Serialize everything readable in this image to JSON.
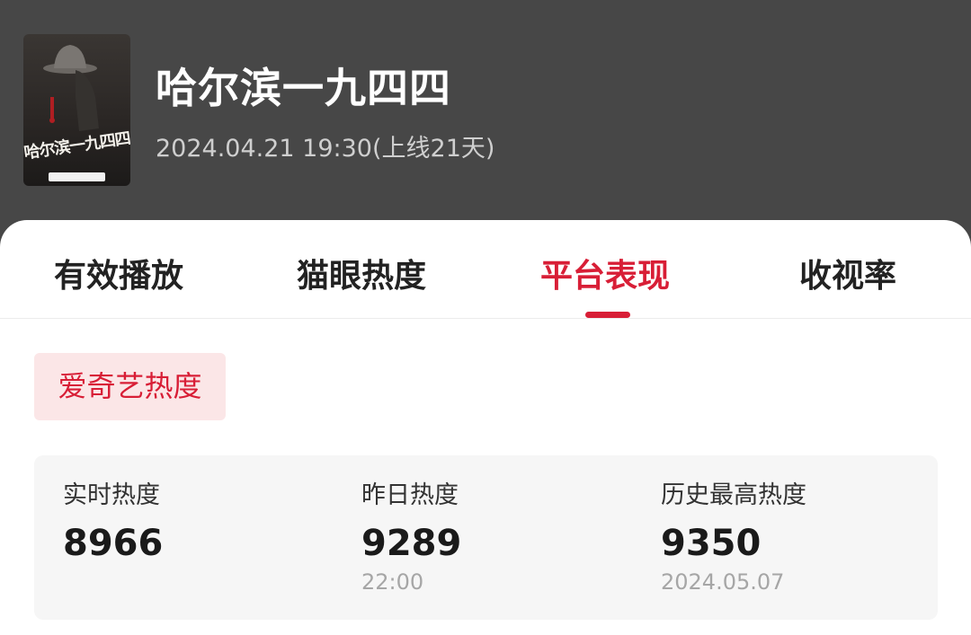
{
  "show": {
    "title": "哈尔滨一九四四",
    "meta": "2024.04.21 19:30(上线21天)",
    "poster_text": "哈尔滨一九四四"
  },
  "tabs": [
    {
      "label": "有效播放",
      "active": false
    },
    {
      "label": "猫眼热度",
      "active": false
    },
    {
      "label": "平台表现",
      "active": true
    },
    {
      "label": "收视率",
      "active": false
    }
  ],
  "platform_chip": {
    "label": "爱奇艺热度"
  },
  "stats": [
    {
      "label": "实时热度",
      "value": "8966",
      "sub": ""
    },
    {
      "label": "昨日热度",
      "value": "9289",
      "sub": "22:00"
    },
    {
      "label": "历史最高热度",
      "value": "9350",
      "sub": "2024.05.07"
    }
  ],
  "colors": {
    "accent": "#d81e36",
    "header_bg": "#474747",
    "chip_bg": "#fbe6e7",
    "panel_bg": "#f6f6f6"
  }
}
